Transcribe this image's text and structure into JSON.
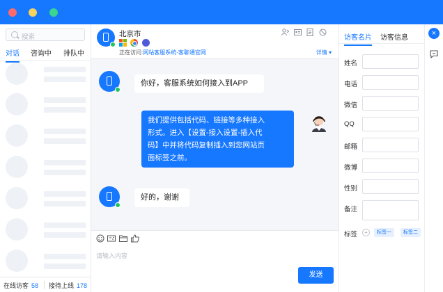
{
  "window": {
    "controls": [
      "close",
      "minimize",
      "maximize"
    ]
  },
  "left": {
    "search_placeholder": "搜索",
    "tabs": [
      "对话",
      "咨询中",
      "排队中"
    ],
    "footer": {
      "online_label": "在线访客",
      "online_count": "58",
      "served_label": "接待上线",
      "served_count": "178"
    }
  },
  "chat": {
    "header": {
      "city": "北京市",
      "visiting_label": "正在访问:",
      "visiting_page": "网站客服系统-客聊通官网",
      "details": "详情 ▾"
    },
    "messages": [
      {
        "from": "visitor",
        "text": "你好，客服系统如何接入到APP"
      },
      {
        "from": "agent",
        "lines": [
          "我们提供包括代码、链接等多种接入",
          "形式。进入【设置-接入设置-插入代",
          "码】中并将代码复制插入到您网站页",
          "面标签之前。"
        ]
      },
      {
        "from": "visitor",
        "text": "好的，谢谢"
      }
    ],
    "composer": {
      "placeholder": "请输入内容",
      "send_label": "发送"
    }
  },
  "visitor_panel": {
    "tabs": [
      "访客名片",
      "访客信息"
    ],
    "fields": [
      "姓名",
      "电话",
      "微信",
      "QQ",
      "邮箱",
      "微博",
      "性别",
      "备注"
    ],
    "tag_label": "标签",
    "tags": [
      "标签一",
      "标签二"
    ]
  },
  "colors": {
    "accent": "#1677ff",
    "online": "#21c45d",
    "chat_bg": "#f4f6fa"
  }
}
